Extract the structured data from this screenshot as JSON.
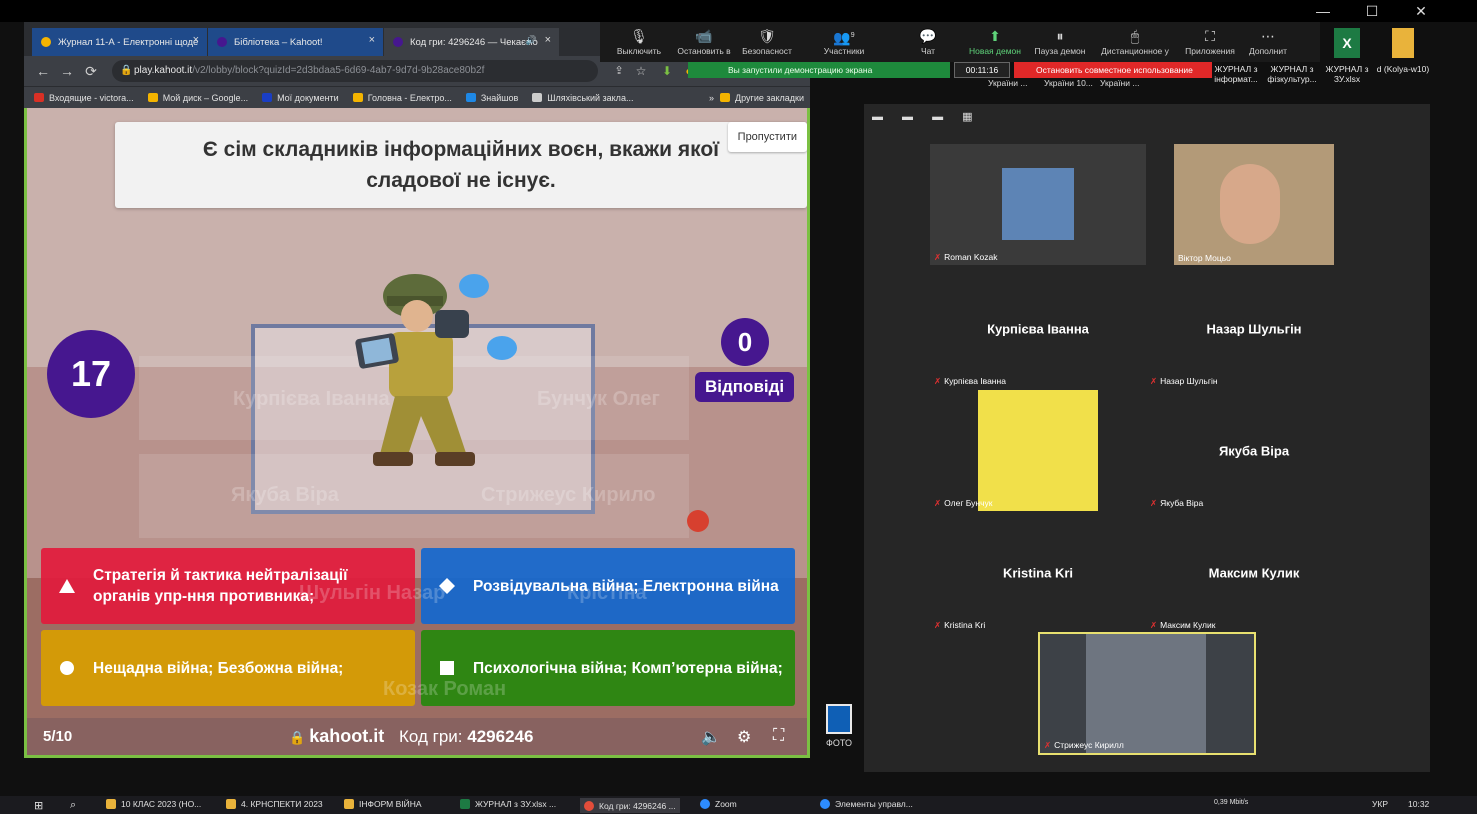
{
  "window": {
    "minimize": "—",
    "maximize": "☐",
    "close": "✕"
  },
  "browser": {
    "tabs": [
      {
        "label": "Журнал 11-А - Електронні щоде",
        "close": "×",
        "color": "#f5b400"
      },
      {
        "label": "Бібліотека – Kahoot!",
        "close": "×",
        "color": "#46178f"
      },
      {
        "label": "Код гри: 4296246 — Чекаємо",
        "close": "×",
        "sound": "🔊",
        "color": "#46178f"
      }
    ],
    "nav": {
      "back": "←",
      "forward": "→",
      "reload": "⟳"
    },
    "url_host": "play.kahoot.it",
    "url_path": "/v2/lobby/block?quizId=2d3bdaa5-6d69-4ab7-9d7d-9b28ace80b2f",
    "lock": "🔒",
    "bookmarks": [
      {
        "label": "Входящие - victora...",
        "color": "#d93025"
      },
      {
        "label": "Мой диск – Google...",
        "color": "#f4b400"
      },
      {
        "label": "Мої документи",
        "color": "#1a3ec4"
      },
      {
        "label": "Головна - Електро...",
        "color": "#f4b400"
      },
      {
        "label": "Знайшов",
        "color": "#1e88e5"
      },
      {
        "label": "Шляхівський закла...",
        "color": "#cccccc"
      }
    ],
    "bookmarks_more": "»",
    "other_bookmarks": "Другие закладки"
  },
  "kahoot": {
    "question": "Є сім складників інформаційних воєн, вкажи якої сладової не існує.",
    "skip_label": "Пропустити",
    "timer": "17",
    "answers_count": "0",
    "answers_label": "Відповіді",
    "answers": [
      {
        "text": "Стратегія й тактика нейтралізації органів упр-ння противника;",
        "shape": "triangle"
      },
      {
        "text": "Розвідувальна війна; Електронна війна",
        "shape": "diamond"
      },
      {
        "text": "Нещадна війна; Безбожна війна;",
        "shape": "circle"
      },
      {
        "text": "Психологічна війна; Комп’ютерна війна;",
        "shape": "square"
      }
    ],
    "bg_names": [
      "Курпієва Іванна",
      "Бунчук Олег",
      "Якуба Віра",
      "Стрижеус Кирило",
      "Шульгін Назар",
      "Крістіна",
      "Козак Роман"
    ],
    "page": "5/10",
    "site": "kahoot.it",
    "code_label": "Код гри:",
    "code_value": "4296246"
  },
  "zoom_toolbar": {
    "buttons": [
      {
        "label": "Выключить",
        "icon": "🎙"
      },
      {
        "label": "Остановить в",
        "icon": "📹"
      },
      {
        "label": "Безопасност",
        "icon": "🛡"
      },
      {
        "label": "Участники",
        "icon": "👥",
        "count": "9"
      },
      {
        "label": "Чат",
        "icon": "💬"
      },
      {
        "label": "Новая демон",
        "icon": "⬆"
      },
      {
        "label": "Пауза демон",
        "icon": "⏸"
      },
      {
        "label": "Дистанционное у",
        "icon": "🖱"
      },
      {
        "label": "Приложения",
        "icon": "⛶"
      },
      {
        "label": "Дополнит",
        "icon": "⋯"
      }
    ],
    "sharing_notice": "Вы запустили демонстрацию экрана",
    "timer": "00:11:16",
    "stop_share": "Остановить совместное использование",
    "desk_labels": [
      "України ...",
      "України 10...",
      "України ..."
    ]
  },
  "desktop_icons": [
    {
      "label": "ЖУРНАЛ з інформат..."
    },
    {
      "label": "ЖУРНАЛ з фізкультур..."
    },
    {
      "label": "ЖУРНАЛ з ЗУ.xlsx"
    },
    {
      "label": "d (Kolya-w10)"
    }
  ],
  "gallery": {
    "tools": "▬ ▬ ▬ ▦",
    "tiles": [
      {
        "name": "Roman Kozak"
      },
      {
        "name": "Віктор Моцьо"
      },
      {
        "name": "Курпієва Іванна",
        "big": "Курпієва Іванна"
      },
      {
        "name": "Назар Шульгін",
        "big": "Назар Шульгін"
      },
      {
        "name": "Олег Бунчук"
      },
      {
        "name": "Якуба Віра",
        "big": "Якуба Віра"
      },
      {
        "name": "Kristina Kri",
        "big": "Kristina Kri"
      },
      {
        "name": "Максим Кулик",
        "big": "Максим Кулик"
      },
      {
        "name": "Стрижеус Кирилл"
      }
    ]
  },
  "foto_label": "ФОТО",
  "taskbar": {
    "items": [
      {
        "label": "10 КЛАС 2023 (НО..."
      },
      {
        "label": "4. КРНСПЕКТИ 2023"
      },
      {
        "label": "ІНФОРМ ВІЙНА"
      },
      {
        "label": "ЖУРНАЛ з ЗУ.xlsx ..."
      },
      {
        "label": "Код гри: 4296246 ..."
      },
      {
        "label": "Zoom"
      },
      {
        "label": "Элементы управл..."
      }
    ],
    "network": "0,39 Mbit/s",
    "lang": "УКР",
    "time": "10:32"
  }
}
